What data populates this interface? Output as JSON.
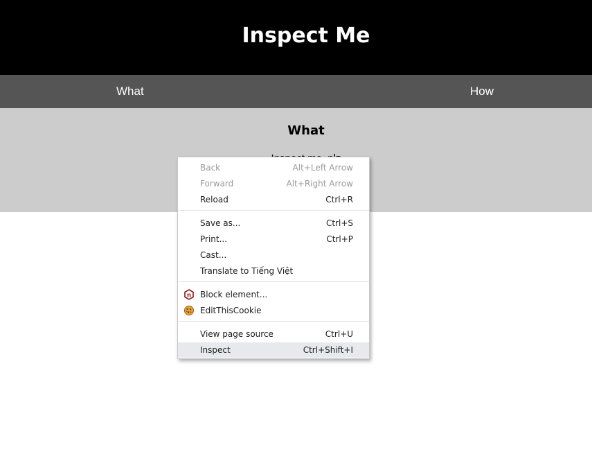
{
  "header": {
    "title": "Inspect Me"
  },
  "nav": {
    "items": [
      {
        "label": "What"
      },
      {
        "label": "How"
      }
    ]
  },
  "section": {
    "heading": "What",
    "text": "Inspect me, plz"
  },
  "context_menu": {
    "items": [
      {
        "label": "Back",
        "shortcut": "Alt+Left Arrow",
        "enabled": false
      },
      {
        "label": "Forward",
        "shortcut": "Alt+Right Arrow",
        "enabled": false
      },
      {
        "label": "Reload",
        "shortcut": "Ctrl+R",
        "enabled": true
      },
      {
        "label": "Save as...",
        "shortcut": "Ctrl+S",
        "enabled": true
      },
      {
        "label": "Print...",
        "shortcut": "Ctrl+P",
        "enabled": true
      },
      {
        "label": "Cast...",
        "shortcut": "",
        "enabled": true
      },
      {
        "label": "Translate to Tiếng Việt",
        "shortcut": "",
        "enabled": true
      },
      {
        "label": "Block element...",
        "shortcut": "",
        "enabled": true,
        "icon": "ublock-hexagon-icon"
      },
      {
        "label": "EditThisCookie",
        "shortcut": "",
        "enabled": true,
        "icon": "cookie-icon"
      },
      {
        "label": "View page source",
        "shortcut": "Ctrl+U",
        "enabled": true
      },
      {
        "label": "Inspect",
        "shortcut": "Ctrl+Shift+I",
        "enabled": true,
        "hovered": true
      }
    ]
  },
  "colors": {
    "header_bg": "#000000",
    "nav_bg": "#555555",
    "section_bg": "#cccccc",
    "menu_hover": "#e8e9ed",
    "menu_disabled_text": "#9a9a9a"
  }
}
